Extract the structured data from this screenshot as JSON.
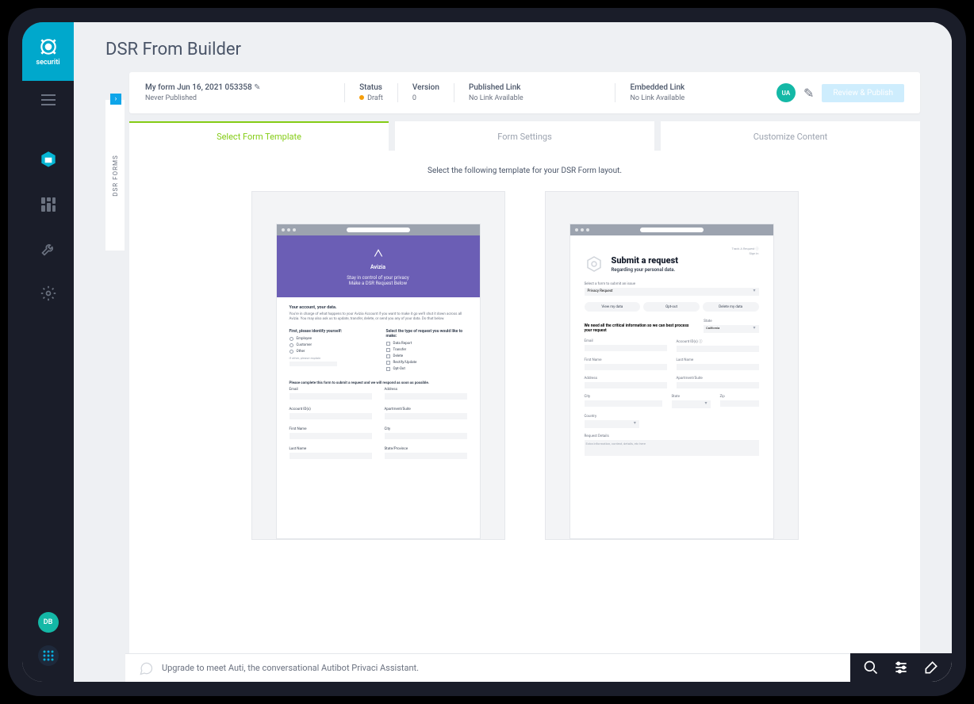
{
  "brand": {
    "name": "securiti"
  },
  "page_title": "DSR From Builder",
  "side_rail": "DSR FORMS",
  "info_bar": {
    "form_name": "My form Jun 16, 2021 053358",
    "form_state": "Never Published",
    "status_label": "Status",
    "status_value": "Draft",
    "version_label": "Version",
    "version_value": "0",
    "published_link_label": "Published Link",
    "published_link_value": "No Link Available",
    "embedded_link_label": "Embedded Link",
    "embedded_link_value": "No Link Available",
    "ua_badge": "UA",
    "review_button": "Review & Publish"
  },
  "tabs": {
    "select_template": "Select Form Template",
    "form_settings": "Form Settings",
    "customize_content": "Customize Content"
  },
  "content_hint": "Select the following template for your DSR Form layout.",
  "template1": {
    "brand": "Avizia",
    "line1": "Stay in control of your privacy",
    "line2": "Make a DSR Request Below",
    "section_h": "Your account, your data.",
    "section_p": "You're in charge of what happens to your Avizia Account if you want to make it go we'll shut it down across all Avizia. You may also ask us to update, transfer, delete, or send you any of your data. Do that below.",
    "col1_h": "First, please identify yourself:",
    "col2_h": "Select the type of request you would like to make:",
    "r1": "Employee",
    "r2": "Customer",
    "r3": "Other",
    "other_ph": "If other, please explain",
    "c1": "Data Report",
    "c2": "Transfer",
    "c3": "Delete",
    "c4": "Rectify/Update",
    "c5": "Opt-Out",
    "form_hint": "Please complete this form to submit a request and we will respond as soon as possible.",
    "f_email": "Email",
    "f_addr": "Address",
    "f_aid": "Account ID(s)",
    "f_apt": "Apartment/Suite",
    "f_fn": "First Name",
    "f_city": "City",
    "f_ln": "Last Name",
    "f_state": "State/Province"
  },
  "template2": {
    "title": "Submit a request",
    "subtitle": "Regarding your personal data.",
    "select_lbl": "Select a form to submit an issue",
    "select_val": "Privacy Request",
    "btn1": "View my data",
    "btn2": "Opt-out",
    "btn3": "Delete my data",
    "crit_lbl": "We need all the critical information so we can best process your request",
    "state_lbl": "State",
    "state_val": "California",
    "email": "Email",
    "aid": "Account ID(s)",
    "fn": "First Name",
    "ln": "Last Name",
    "addr": "Address",
    "apt": "Apartment/Suite",
    "city": "City",
    "state": "State",
    "zip": "Zip",
    "country": "Country",
    "details": "Request Details",
    "details_ph": "Extra information, context, details, etc here"
  },
  "bottom_bar": {
    "text": "Upgrade to meet Auti, the conversational Autibot Privaci Assistant."
  },
  "sidebar_user": "DB"
}
